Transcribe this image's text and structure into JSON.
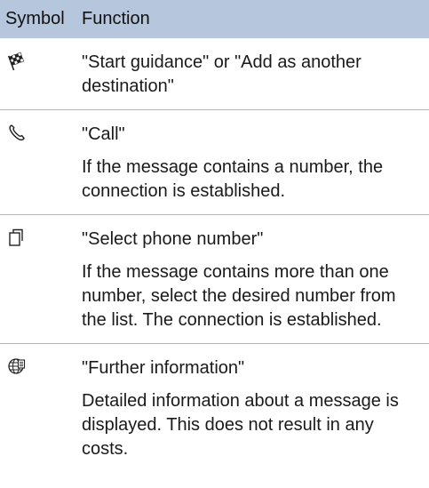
{
  "header": {
    "symbol": "Symbol",
    "function": "Function"
  },
  "rows": [
    {
      "icon": "flag-icon",
      "title": "\"Start guidance\" or \"Add as another destination\"",
      "description": ""
    },
    {
      "icon": "phone-icon",
      "title": "\"Call\"",
      "description": "If the message contains a number, the connection is established."
    },
    {
      "icon": "phone-number-icon",
      "title": "\"Select phone number\"",
      "description": "If the message contains more than one number, select the desired number from the list. The connection is established."
    },
    {
      "icon": "globe-info-icon",
      "title": "\"Further information\"",
      "description": "Detailed information about a message is displayed. This does not result in any costs."
    }
  ]
}
